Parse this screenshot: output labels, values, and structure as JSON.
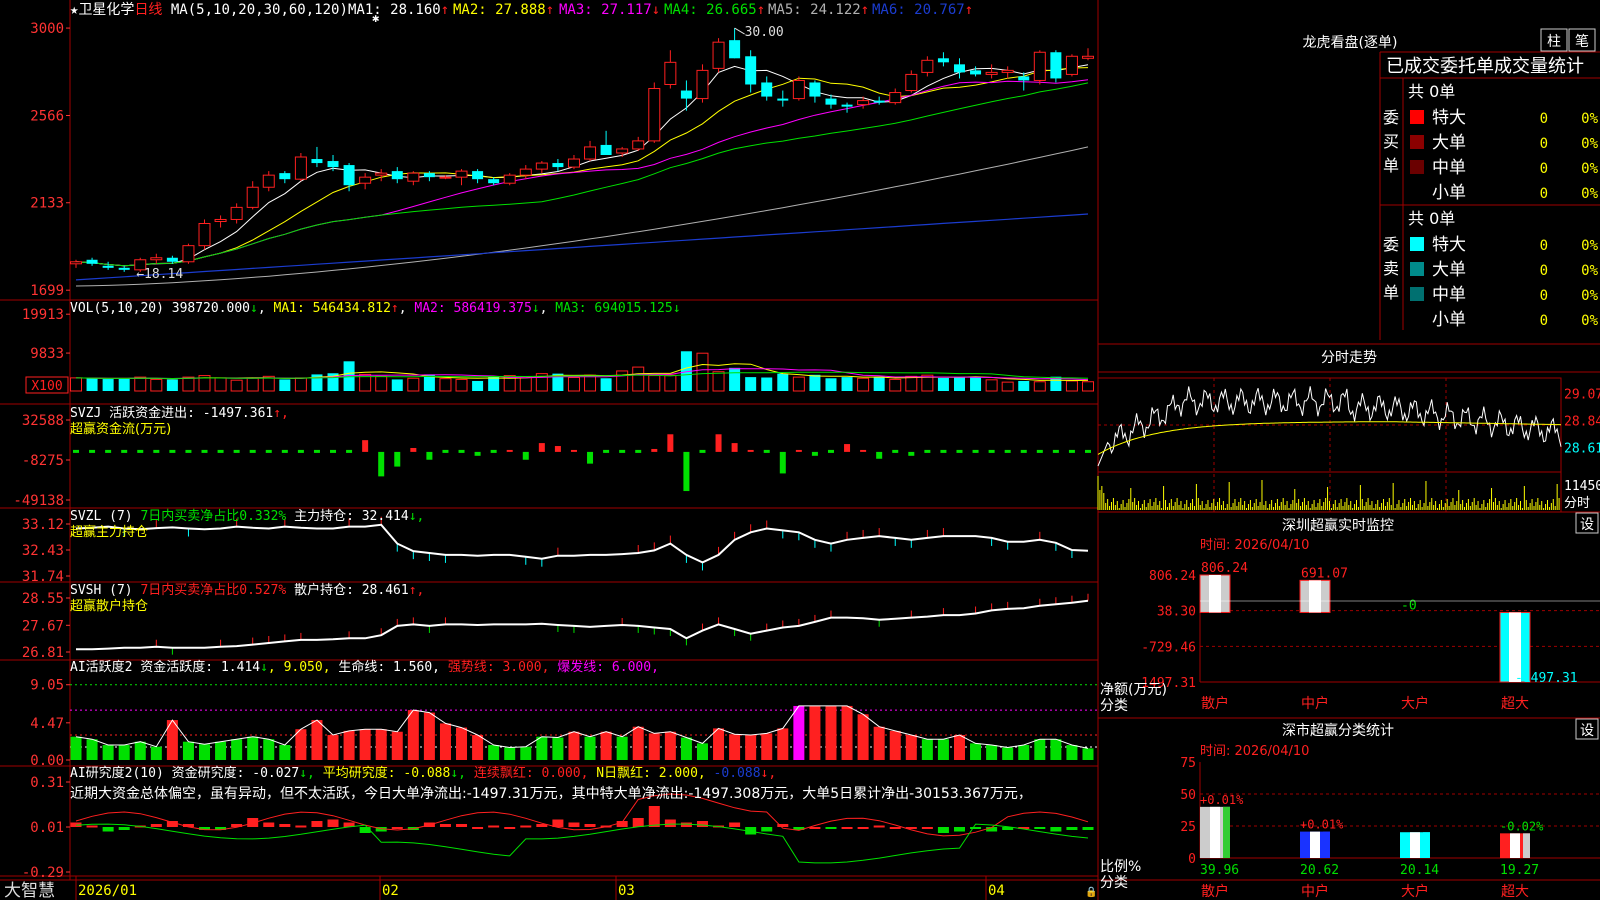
{
  "colors": {
    "up": "#ff2020",
    "down": "#00ffff",
    "grid": "#a00000",
    "axisText": "#ff3333",
    "white": "#ffffff",
    "yellow": "#ffff00",
    "magenta": "#ff00ff",
    "green": "#00e000",
    "blue": "#1b3ccf",
    "gray": "#b0b0b0",
    "bg": "#000000"
  },
  "main": {
    "header": {
      "star": "★",
      "name": "卫星化学",
      "period": "日线",
      "ma_label": "MA(5,10,20,30,60,120)",
      "ma": [
        {
          "label": "MA1:",
          "value": "28.160",
          "arrow": "↑"
        },
        {
          "label": "MA2:",
          "value": "27.888",
          "arrow": "↑"
        },
        {
          "label": "MA3:",
          "value": "27.117",
          "arrow": "↓"
        },
        {
          "label": "MA4:",
          "value": "26.665",
          "arrow": "↑"
        },
        {
          "label": "MA5:",
          "value": "24.122",
          "arrow": "↑"
        },
        {
          "label": "MA6:",
          "value": "20.767",
          "arrow": "↑"
        }
      ]
    },
    "y_ticks": [
      "3000",
      "2566",
      "2133",
      "1699"
    ],
    "high_label": "30.00",
    "low_label": "18.14"
  },
  "vol": {
    "label": "VOL(5,10,20)",
    "value": "398720.000",
    "arrow": "↓",
    "ma1": "MA1: 546434.812",
    "ma1_arrow": "↑",
    "ma2": "MA2: 586419.375",
    "ma2_arrow": "↓",
    "ma3": "MA3: 694015.125",
    "ma3_arrow": "↓",
    "y_ticks": [
      "19913",
      "9833"
    ],
    "unit": "X100"
  },
  "svzj": {
    "label": "SVZJ  活跃资金进出: -1497.361",
    "arrow": "↑,",
    "sub": "超赢资金流(万元)",
    "y_ticks": [
      "32588",
      "-8275",
      "-49138"
    ]
  },
  "svzl": {
    "label": "SVZL (7)",
    "desc": "7日内买卖净占比0.332%",
    "hold": " 主力持仓: 32.414",
    "arrow": "↓,",
    "sub": "超赢主力持仓",
    "y_ticks": [
      "33.12",
      "32.43",
      "31.74"
    ]
  },
  "svsh": {
    "label": "SVSH (7)",
    "desc": "7日内买卖净占比0.527%",
    "hold": " 散户持仓: 28.461",
    "arrow": "↑,",
    "sub": "超赢散户持仓",
    "y_ticks": [
      "28.55",
      "27.67",
      "26.81"
    ]
  },
  "ai1": {
    "label": "AI活跃度2 资金活跃度: 1.414",
    "arrow": "↓",
    "v2": ", 9.050,",
    "life": " 生命线: 1.560,",
    "strong": " 强势线: 3.000,",
    "burst": " 爆发线: 6.000,",
    "y_ticks": [
      "9.05",
      "4.47",
      "0.00"
    ]
  },
  "ai2": {
    "label": "AI研究度2(10) 资金研究度: -0.027",
    "arrow": "↓,",
    "avg": " 平均研究度: -0.088",
    "avg_arrow": "↓,",
    "red": " 连续飘红: 0.000,",
    "nred": " N日飘红: 2.000,",
    "last": " -0.088",
    "last_arrow": "↓,",
    "comment": "近期大资金总体偏空，虽有异动，但不太活跃，今日大单净流出:-1497.31万元，其中特大单净流出:-1497.308万元，大单5日累计净出-30153.367万元，",
    "y_ticks": [
      "0.31",
      "0.01",
      "-0.29"
    ]
  },
  "xaxis": {
    "brand": "大智慧",
    "dates": [
      "2026/01",
      "02",
      "03",
      "04"
    ]
  },
  "right": {
    "dragon": {
      "title": "龙虎看盘(逐单)",
      "btn_bar": "柱",
      "btn_pen": "笔",
      "tabs": "已成交委托单成交量统计",
      "buy": {
        "side": "委买单",
        "total": "共 0单",
        "rows": [
          {
            "label": "特大",
            "count": "0",
            "pct": "0%",
            "color": "#ff0000"
          },
          {
            "label": "大单",
            "count": "0",
            "pct": "0%",
            "color": "#8b0000"
          },
          {
            "label": "中单",
            "count": "0",
            "pct": "0%",
            "color": "#6a0000"
          },
          {
            "label": "小单",
            "count": "0",
            "pct": "0%",
            "color": "#000000"
          }
        ]
      },
      "sell": {
        "side": "委卖单",
        "total": "共 0单",
        "rows": [
          {
            "label": "特大",
            "count": "0",
            "pct": "0%",
            "color": "#00ffff"
          },
          {
            "label": "大单",
            "count": "0",
            "pct": "0%",
            "color": "#008b8b"
          },
          {
            "label": "中单",
            "count": "0",
            "pct": "0%",
            "color": "#007070"
          },
          {
            "label": "小单",
            "count": "0",
            "pct": "0%",
            "color": "#000000"
          }
        ]
      }
    },
    "intraday": {
      "title": "分时走势",
      "y_ticks": [
        "29.07",
        "28.84",
        "28.61"
      ],
      "vol_tick": "11450",
      "unit": "分时"
    },
    "monitor": {
      "title": "深圳超赢实时监控",
      "btn": "设",
      "time": "时间: 2026/04/10",
      "y_ticks": [
        "806.24",
        "38.30",
        "-729.46",
        "-1497.31"
      ],
      "ylabel": "净额(万元)",
      "xlabel": "分类",
      "bars": [
        {
          "name": "散户",
          "value": "806.24"
        },
        {
          "name": "中户",
          "value": "691.07"
        },
        {
          "name": "大户",
          "value": "-0"
        },
        {
          "name": "超大",
          "value": "-1497.31"
        }
      ]
    },
    "classify": {
      "title": "深市超赢分类统计",
      "btn": "设",
      "time": "时间: 2026/04/10",
      "y_ticks": [
        "75",
        "50",
        "25",
        "0"
      ],
      "ylabel": "比例%",
      "xlabel": "分类",
      "bars": [
        {
          "name": "散户",
          "value": "39.96",
          "change": "+0.01%"
        },
        {
          "name": "中户",
          "value": "20.62",
          "change": "+0.01%"
        },
        {
          "name": "大户",
          "value": "20.14",
          "change": ""
        },
        {
          "name": "超大",
          "value": "19.27",
          "change": "-0.02%"
        }
      ]
    }
  },
  "chart_data": [
    {
      "type": "candlestick",
      "title": "卫星化学 日线",
      "ylim": [
        16.9,
        30.5
      ],
      "y_tick_labels": [
        "3000",
        "2566",
        "2133",
        "1699"
      ],
      "ohlc": [
        [
          18.3,
          18.5,
          18.1,
          18.4
        ],
        [
          18.5,
          18.6,
          18.2,
          18.3
        ],
        [
          18.2,
          18.4,
          18.0,
          18.1
        ],
        [
          18.1,
          18.2,
          17.9,
          18.0
        ],
        [
          18.0,
          18.6,
          17.9,
          18.5
        ],
        [
          18.5,
          18.8,
          18.3,
          18.6
        ],
        [
          18.6,
          18.7,
          18.3,
          18.4
        ],
        [
          18.4,
          19.3,
          18.3,
          19.2
        ],
        [
          19.2,
          20.5,
          19.0,
          20.3
        ],
        [
          20.4,
          20.7,
          20.1,
          20.5
        ],
        [
          20.5,
          21.3,
          20.3,
          21.1
        ],
        [
          21.1,
          22.4,
          21.0,
          22.1
        ],
        [
          22.1,
          22.9,
          21.9,
          22.7
        ],
        [
          22.8,
          22.9,
          22.3,
          22.5
        ],
        [
          22.5,
          23.8,
          22.4,
          23.6
        ],
        [
          23.5,
          24.1,
          23.1,
          23.3
        ],
        [
          23.4,
          23.7,
          22.9,
          23.1
        ],
        [
          23.2,
          23.3,
          21.9,
          22.2
        ],
        [
          22.3,
          22.8,
          22.0,
          22.6
        ],
        [
          22.7,
          23.0,
          22.4,
          22.8
        ],
        [
          22.9,
          23.1,
          22.3,
          22.5
        ],
        [
          22.4,
          22.9,
          22.2,
          22.8
        ],
        [
          22.8,
          22.9,
          22.4,
          22.6
        ],
        [
          22.6,
          22.7,
          22.5,
          22.6
        ],
        [
          22.6,
          23.0,
          22.2,
          22.9
        ],
        [
          22.9,
          23.0,
          22.3,
          22.5
        ],
        [
          22.5,
          22.6,
          22.2,
          22.3
        ],
        [
          22.3,
          22.8,
          22.2,
          22.7
        ],
        [
          22.7,
          23.2,
          22.5,
          23.0
        ],
        [
          23.0,
          23.4,
          22.8,
          23.3
        ],
        [
          23.3,
          23.5,
          22.9,
          23.1
        ],
        [
          23.1,
          23.7,
          23.0,
          23.5
        ],
        [
          23.5,
          24.4,
          23.4,
          24.1
        ],
        [
          24.2,
          24.9,
          24.0,
          23.7
        ],
        [
          23.8,
          24.1,
          23.6,
          24.0
        ],
        [
          24.0,
          24.6,
          23.9,
          24.4
        ],
        [
          24.4,
          27.3,
          24.3,
          27.0
        ],
        [
          27.2,
          28.9,
          27.0,
          28.3
        ],
        [
          26.9,
          27.4,
          25.9,
          26.5
        ],
        [
          26.5,
          28.2,
          26.3,
          27.9
        ],
        [
          28.0,
          29.5,
          27.8,
          29.3
        ],
        [
          29.4,
          30.0,
          28.5,
          28.5
        ],
        [
          28.6,
          28.9,
          26.8,
          27.2
        ],
        [
          27.3,
          27.6,
          26.4,
          26.6
        ],
        [
          26.5,
          26.9,
          26.1,
          26.4
        ],
        [
          26.5,
          27.6,
          26.4,
          27.4
        ],
        [
          27.3,
          27.4,
          26.3,
          26.6
        ],
        [
          26.5,
          26.7,
          26.0,
          26.2
        ],
        [
          26.2,
          26.3,
          25.8,
          26.1
        ],
        [
          26.2,
          26.6,
          26.0,
          26.4
        ],
        [
          26.4,
          26.6,
          26.2,
          26.3
        ],
        [
          26.3,
          27.0,
          26.2,
          26.8
        ],
        [
          26.9,
          27.9,
          26.8,
          27.7
        ],
        [
          27.8,
          28.6,
          27.6,
          28.4
        ],
        [
          28.5,
          28.8,
          28.1,
          28.3
        ],
        [
          28.2,
          28.5,
          27.5,
          27.8
        ],
        [
          27.9,
          28.1,
          27.6,
          27.7
        ],
        [
          27.7,
          28.2,
          27.5,
          27.8
        ],
        [
          27.8,
          28.1,
          27.5,
          27.9
        ],
        [
          27.6,
          27.8,
          26.9,
          27.4
        ],
        [
          27.4,
          28.9,
          27.2,
          28.8
        ],
        [
          28.8,
          28.9,
          27.3,
          27.5
        ],
        [
          27.7,
          28.7,
          27.6,
          28.6
        ],
        [
          28.5,
          29.0,
          28.4,
          28.6
        ]
      ],
      "series": [
        {
          "name": "MA1",
          "color": "#ffffff"
        },
        {
          "name": "MA2",
          "color": "#ffff00"
        },
        {
          "name": "MA3",
          "color": "#ff00ff"
        },
        {
          "name": "MA4",
          "color": "#00e000"
        },
        {
          "name": "MA5",
          "color": "#b0b0b0"
        },
        {
          "name": "MA6",
          "color": "#1b3ccf"
        }
      ],
      "ma5": [
        18.0,
        18.1,
        18.2,
        18.2,
        18.4,
        18.5,
        18.7,
        19.0,
        19.4,
        19.9,
        20.4,
        20.9,
        21.4,
        21.9,
        22.3,
        22.6,
        22.8,
        22.8,
        22.7,
        22.6,
        22.6,
        22.6,
        22.6,
        22.6,
        22.7,
        22.7,
        22.6,
        22.6,
        22.7,
        22.8,
        23.0,
        23.2,
        23.5,
        23.7,
        23.9,
        24.6,
        25.3,
        25.9,
        26.7,
        27.4,
        28.0,
        28.2,
        28.0,
        27.6,
        27.2,
        26.9,
        26.6,
        26.4,
        26.3,
        26.3,
        26.4,
        26.6,
        27.0,
        27.4,
        27.7,
        27.9,
        28.0,
        27.9,
        27.8,
        27.9,
        28.0,
        28.0,
        28.1,
        28.4
      ]
    },
    {
      "type": "bar",
      "title": "VOL(5,10,20)",
      "unit": "X100",
      "ylim": [
        0,
        21000
      ],
      "values": [
        3400,
        3300,
        3100,
        3300,
        3600,
        3000,
        3000,
        3600,
        4000,
        3400,
        2800,
        3300,
        3800,
        3000,
        3400,
        4300,
        4600,
        7700,
        4300,
        3800,
        3000,
        3300,
        4300,
        3200,
        3000,
        2600,
        3700,
        4000,
        3700,
        4500,
        4500,
        3500,
        4100,
        3300,
        5200,
        6200,
        4000,
        4100,
        10300,
        9800,
        5000,
        6000,
        3600,
        3500,
        4500,
        3600,
        4200,
        3300,
        3600,
        3300,
        3700,
        3000,
        3800,
        4100,
        3400,
        3600,
        3600,
        2900,
        2300,
        2600,
        2400,
        3700,
        2600,
        2400
      ]
    },
    {
      "type": "bar",
      "title": "超赢资金流(万元)",
      "ylim": [
        -49138,
        32588
      ],
      "values": [
        -1000,
        -2000,
        -3500,
        -2000,
        -1000,
        -2000,
        -3500,
        -2000,
        -1000,
        -3500,
        -2000,
        -1000,
        -2000,
        -3500,
        -2000,
        -1000,
        -2000,
        -3000,
        12000,
        -25000,
        -15000,
        4000,
        -8000,
        -3500,
        -2000,
        -4000,
        -2000,
        2000,
        -8000,
        9000,
        6000,
        2000,
        -12000,
        -3000,
        -2000,
        -2000,
        3000,
        18000,
        -40000,
        -2000,
        18000,
        9000,
        2000,
        -3000,
        -22000,
        2000,
        -4000,
        -2000,
        8000,
        2000,
        -7000,
        -2000,
        -4000,
        -3000,
        -1000,
        -3000,
        -2000,
        -3000,
        -3500,
        -2000,
        -1000,
        -2000,
        -1000,
        -2000
      ]
    },
    {
      "type": "line",
      "title": "超赢主力持仓",
      "ylim": [
        31.74,
        33.12
      ],
      "values": [
        33.0,
        33.02,
        33.05,
        33.0,
        32.98,
        33.01,
        33.03,
        33.0,
        32.98,
        33.0,
        33.05,
        33.02,
        33.0,
        33.05,
        33.02,
        33.0,
        33.0,
        33.05,
        33.05,
        33.1,
        32.6,
        32.4,
        32.35,
        32.3,
        32.3,
        32.28,
        32.3,
        32.3,
        32.25,
        32.2,
        32.28,
        32.28,
        32.3,
        32.3,
        32.32,
        32.35,
        32.42,
        32.6,
        32.3,
        32.1,
        32.3,
        32.7,
        32.9,
        33.0,
        32.95,
        32.9,
        32.7,
        32.6,
        32.7,
        32.75,
        32.8,
        32.75,
        32.7,
        32.75,
        32.8,
        32.8,
        32.8,
        32.75,
        32.65,
        32.65,
        32.7,
        32.62,
        32.43,
        32.41
      ]
    },
    {
      "type": "line",
      "title": "超赢散户持仓",
      "ylim": [
        26.81,
        28.55
      ],
      "values": [
        26.9,
        26.9,
        26.92,
        26.95,
        26.95,
        26.98,
        26.95,
        26.95,
        26.95,
        26.98,
        27.0,
        27.05,
        27.1,
        27.15,
        27.2,
        27.2,
        27.22,
        27.25,
        27.25,
        27.35,
        27.65,
        27.7,
        27.65,
        27.7,
        27.7,
        27.68,
        27.7,
        27.7,
        27.7,
        27.72,
        27.68,
        27.65,
        27.62,
        27.65,
        27.68,
        27.65,
        27.6,
        27.55,
        27.25,
        27.5,
        27.7,
        27.55,
        27.4,
        27.5,
        27.6,
        27.65,
        27.78,
        27.92,
        27.92,
        27.9,
        27.85,
        27.88,
        27.92,
        27.95,
        28.0,
        28.0,
        28.05,
        28.15,
        28.2,
        28.22,
        28.3,
        28.35,
        28.4,
        28.46
      ]
    },
    {
      "type": "bar",
      "title": "AI活跃度2",
      "ylim": [
        0,
        10.1
      ],
      "values": [
        2.8,
        2.5,
        1.8,
        1.8,
        2.2,
        1.6,
        4.8,
        2.2,
        1.9,
        2.2,
        2.5,
        2.8,
        2.5,
        1.8,
        3.7,
        4.8,
        3.0,
        3.5,
        3.7,
        3.7,
        3.4,
        6.0,
        5.7,
        4.4,
        3.9,
        3.0,
        1.8,
        1.5,
        1.6,
        2.8,
        2.7,
        3.4,
        2.8,
        3.4,
        2.8,
        4.0,
        3.2,
        3.4,
        2.7,
        2.0,
        3.8,
        3.1,
        3.0,
        3.2,
        3.8,
        6.5,
        6.5,
        6.5,
        6.5,
        5.5,
        4.0,
        3.5,
        3.0,
        2.5,
        2.5,
        3.0,
        2.0,
        1.8,
        1.5,
        1.8,
        2.5,
        2.5,
        1.8,
        1.4
      ]
    },
    {
      "type": "bar",
      "title": "AI研究度2(10)",
      "ylim": [
        -0.29,
        0.31
      ],
      "values": [
        0.03,
        0.01,
        -0.03,
        -0.02,
        0.01,
        0.02,
        0.04,
        0.02,
        -0.02,
        -0.02,
        0.02,
        0.06,
        0.03,
        0.02,
        0.01,
        0.04,
        0.05,
        0.03,
        -0.04,
        -0.03,
        0.0,
        -0.02,
        0.03,
        0.02,
        0.02,
        0.0,
        0.01,
        0.0,
        0.01,
        0.02,
        0.05,
        0.03,
        0.02,
        0.01,
        0.04,
        0.06,
        0.14,
        0.05,
        0.03,
        0.04,
        0.01,
        0.03,
        -0.05,
        -0.03,
        0.02,
        -0.02,
        0.0,
        -0.01,
        0.0,
        0.0,
        0.01,
        0.0,
        0.0,
        0.0,
        -0.04,
        -0.03,
        -0.01,
        -0.03,
        -0.02,
        0.0,
        -0.01,
        -0.03,
        -0.02,
        -0.02
      ]
    }
  ]
}
